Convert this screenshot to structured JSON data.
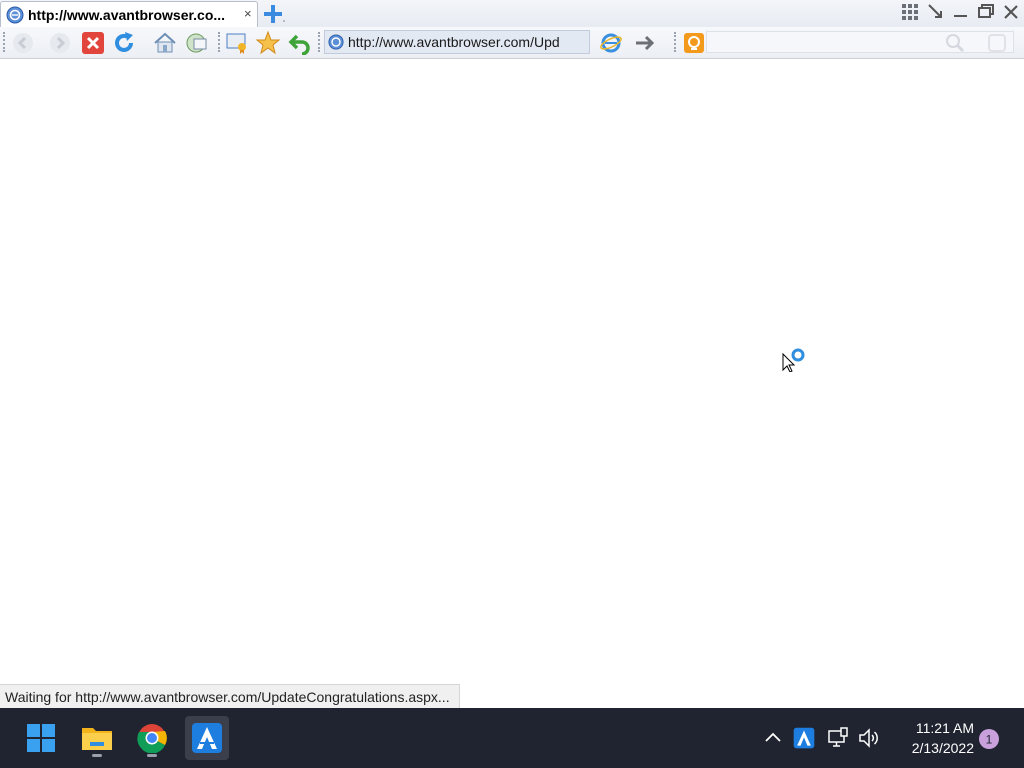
{
  "tab": {
    "title": "http://www.avantbrowser.co...",
    "close_glyph": "×"
  },
  "address": {
    "url": "http://www.avantbrowser.com/Upd"
  },
  "status": {
    "text": "Waiting for http://www.avantbrowser.com/UpdateCongratulations.aspx..."
  },
  "clock": {
    "time": "11:21 AM",
    "date": "2/13/2022"
  },
  "notifications": {
    "count": "1"
  },
  "colors": {
    "accent": "#2f8ee0",
    "stop": "#e2453c",
    "taskbar": "#1f2430",
    "notif_badge": "#c9a0dc"
  },
  "icons": {
    "toolbar": [
      "back-icon",
      "forward-icon",
      "stop-icon",
      "refresh-icon",
      "home-icon",
      "group-icon",
      "collect-icon",
      "favorites-icon",
      "undo-icon",
      "ie-icon",
      "go-arrow-icon",
      "search-engine-icon",
      "search-icon",
      "clear-icon"
    ],
    "window": [
      "grid-icon",
      "restore-down-icon",
      "minimize-icon",
      "maximize-icon",
      "close-icon"
    ],
    "taskbar": [
      "windows-start-icon",
      "file-explorer-icon",
      "chrome-icon",
      "avant-browser-icon"
    ],
    "tray": [
      "chevron-up-icon",
      "avant-tray-icon",
      "network-icon",
      "volume-icon"
    ]
  }
}
